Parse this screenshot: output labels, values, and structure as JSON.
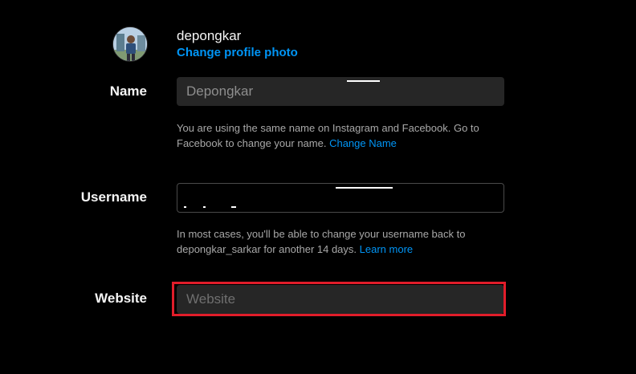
{
  "profile": {
    "username": "depongkar",
    "change_photo_label": "Change profile photo"
  },
  "fields": {
    "name": {
      "label": "Name",
      "value": "Depongkar",
      "help_text": "You are using the same name on Instagram and Facebook. Go to Facebook to change your name.",
      "help_link": "Change Name"
    },
    "username": {
      "label": "Username",
      "value": "",
      "help_text": "In most cases, you'll be able to change your username back to depongkar_sarkar for another 14 days.",
      "help_link": "Learn more"
    },
    "website": {
      "label": "Website",
      "value": "",
      "placeholder": "Website"
    }
  },
  "colors": {
    "background": "#000000",
    "link": "#0095f6",
    "highlight": "#e11d2a",
    "input_bg": "#262626"
  },
  "icons": {
    "avatar": "profile-photo"
  }
}
